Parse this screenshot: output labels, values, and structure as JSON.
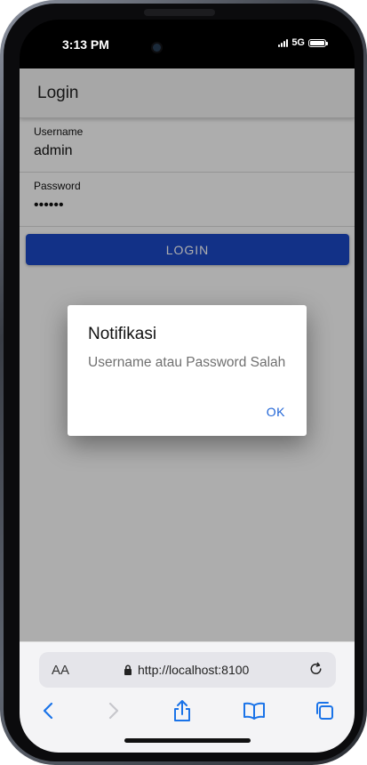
{
  "status_bar": {
    "time": "3:13 PM",
    "network": "5G"
  },
  "app": {
    "toolbar_title": "Login",
    "fields": [
      {
        "label": "Username",
        "value": "admin"
      },
      {
        "label": "Password",
        "value": "••••••"
      }
    ],
    "login_button": "LOGIN"
  },
  "alert": {
    "title": "Notifikasi",
    "message": "Username atau Password Salah",
    "ok_label": "OK"
  },
  "browser": {
    "text_size_label": "AA",
    "url": "http://localhost:8100"
  },
  "colors": {
    "primary": "#1b49c8",
    "alert_button": "#1e63d6",
    "browser_accent": "#1a73e8"
  }
}
